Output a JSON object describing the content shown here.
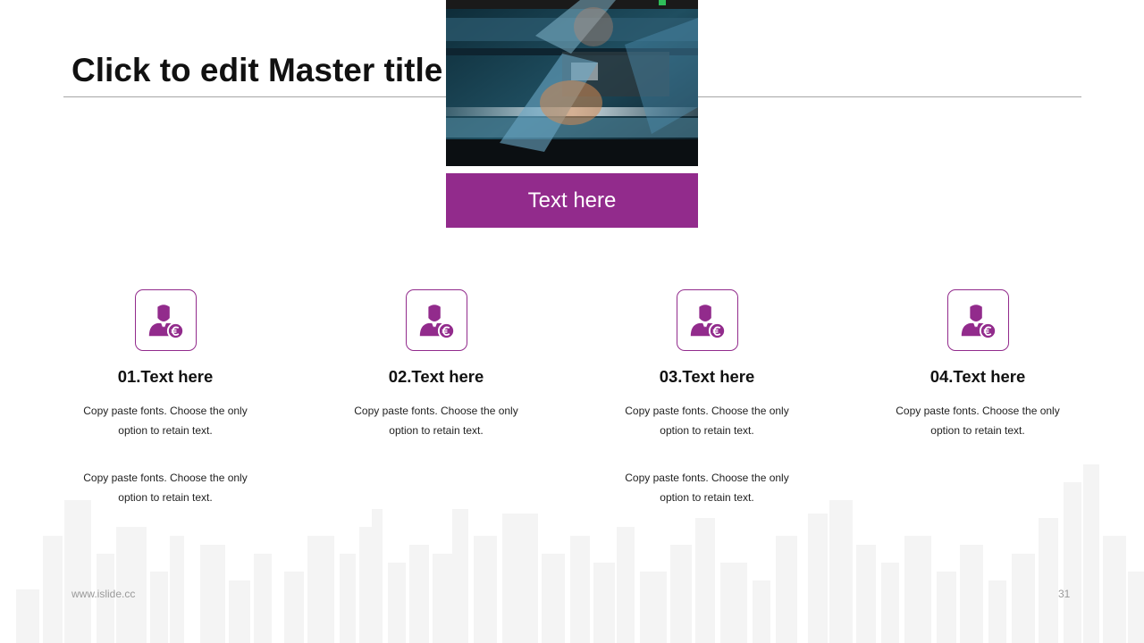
{
  "slide": {
    "title": "Click to edit Master title",
    "banner_text": "Text here",
    "cards": [
      {
        "title": "01.Text here",
        "paragraphs": [
          "Copy paste fonts. Choose the only option to retain text.",
          "Copy paste fonts. Choose the only option to retain text."
        ]
      },
      {
        "title": "02.Text here",
        "paragraphs": [
          "Copy paste fonts. Choose the only option to retain text."
        ]
      },
      {
        "title": "03.Text here",
        "paragraphs": [
          "Copy paste fonts. Choose the only option to retain text.",
          "Copy paste fonts. Choose the only option to retain text."
        ]
      },
      {
        "title": "04.Text here",
        "paragraphs": [
          "Copy paste fonts. Choose the only option to retain text."
        ]
      }
    ],
    "icon": "businessman-euro-icon",
    "footer_url": "www.islide.cc",
    "page_number": "31"
  },
  "colors": {
    "accent": "#922b8c",
    "title_text": "#111111",
    "rule": "#a6a6a6",
    "footer_text": "#9a9a9a",
    "skyline": "#e6e6e6"
  }
}
